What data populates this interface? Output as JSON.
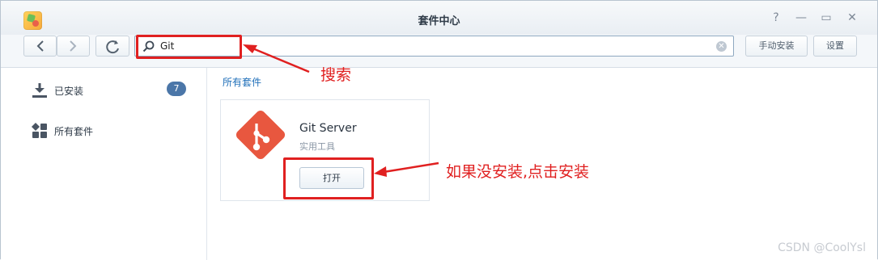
{
  "window": {
    "title": "套件中心"
  },
  "toolbar": {
    "search_value": "Git",
    "manual_install_label": "手动安装",
    "settings_label": "设置"
  },
  "sidebar": {
    "items": [
      {
        "label": "已安装",
        "badge": "7",
        "icon": "download-icon"
      },
      {
        "label": "所有套件",
        "icon": "grid-icon"
      }
    ]
  },
  "main": {
    "section_title": "所有套件",
    "package": {
      "name": "Git Server",
      "category": "实用工具",
      "action_label": "打开"
    }
  },
  "annotations": {
    "search_note": "搜索",
    "install_note": "如果没安装,点击安装"
  },
  "watermark": "CSDN @CoolYsl",
  "colors": {
    "accent_blue": "#1f6fb9",
    "badge_blue": "#4b76a8",
    "annotation_red": "#e02020",
    "git_orange": "#e8573f"
  }
}
